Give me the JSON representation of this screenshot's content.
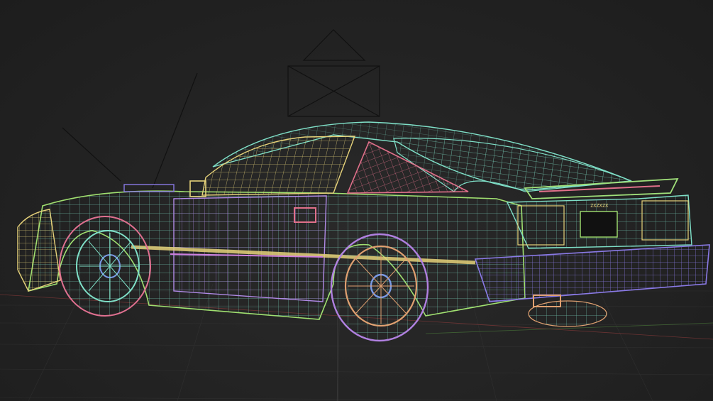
{
  "viewport": {
    "mode": "wireframe",
    "background": "#232323",
    "grid_color": "#3a3a3a",
    "axis_x_color": "#8a3a3a",
    "axis_y_color": "#4a7a3a"
  },
  "model": {
    "plate_badge": "ZXZXZX",
    "colors": {
      "body": "#7fe0c8",
      "glass": "#e6d27a",
      "quarter_glass": "#e0708a",
      "door": "#b08ae6",
      "trim": "#e6d27a",
      "wheel_rear": "#e0a070",
      "tire_rear": "#b080e0",
      "wheel_front": "#7fe0c8",
      "tire_front": "#e07090",
      "bumper": "#8a7ae6",
      "spoiler": "#a0e07a",
      "front_nose": "#e6d27a",
      "edge": "#a0e070"
    }
  },
  "camera_icon": "camera-icon"
}
